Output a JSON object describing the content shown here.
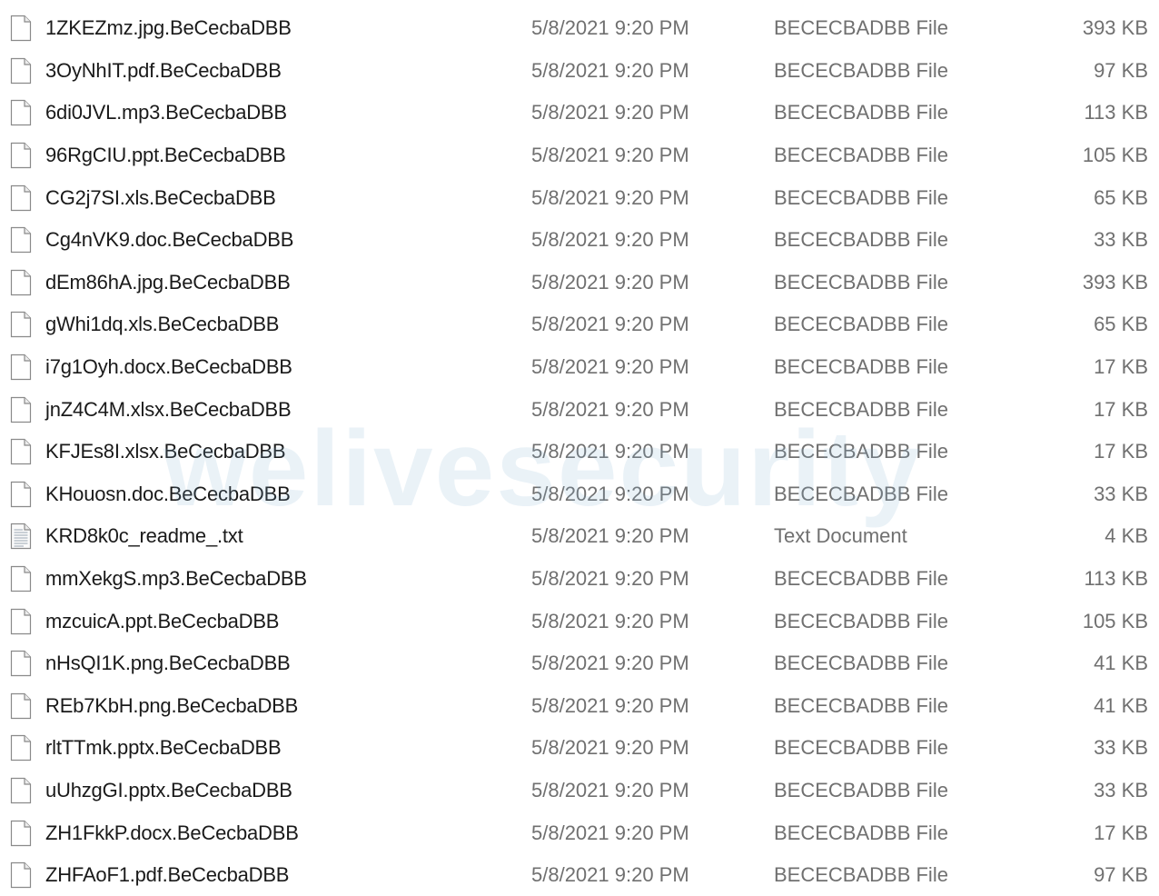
{
  "watermark": "welivesecurity",
  "files": [
    {
      "name": "1ZKEZmz.jpg.BeCecbaDBB",
      "date": "5/8/2021 9:20 PM",
      "type": "BECECBADBB File",
      "size": "393 KB",
      "icon": "blank-file-icon"
    },
    {
      "name": "3OyNhIT.pdf.BeCecbaDBB",
      "date": "5/8/2021 9:20 PM",
      "type": "BECECBADBB File",
      "size": "97 KB",
      "icon": "blank-file-icon"
    },
    {
      "name": "6di0JVL.mp3.BeCecbaDBB",
      "date": "5/8/2021 9:20 PM",
      "type": "BECECBADBB File",
      "size": "113 KB",
      "icon": "blank-file-icon"
    },
    {
      "name": "96RgCIU.ppt.BeCecbaDBB",
      "date": "5/8/2021 9:20 PM",
      "type": "BECECBADBB File",
      "size": "105 KB",
      "icon": "blank-file-icon"
    },
    {
      "name": "CG2j7SI.xls.BeCecbaDBB",
      "date": "5/8/2021 9:20 PM",
      "type": "BECECBADBB File",
      "size": "65 KB",
      "icon": "blank-file-icon"
    },
    {
      "name": "Cg4nVK9.doc.BeCecbaDBB",
      "date": "5/8/2021 9:20 PM",
      "type": "BECECBADBB File",
      "size": "33 KB",
      "icon": "blank-file-icon"
    },
    {
      "name": "dEm86hA.jpg.BeCecbaDBB",
      "date": "5/8/2021 9:20 PM",
      "type": "BECECBADBB File",
      "size": "393 KB",
      "icon": "blank-file-icon"
    },
    {
      "name": "gWhi1dq.xls.BeCecbaDBB",
      "date": "5/8/2021 9:20 PM",
      "type": "BECECBADBB File",
      "size": "65 KB",
      "icon": "blank-file-icon"
    },
    {
      "name": "i7g1Oyh.docx.BeCecbaDBB",
      "date": "5/8/2021 9:20 PM",
      "type": "BECECBADBB File",
      "size": "17 KB",
      "icon": "blank-file-icon"
    },
    {
      "name": "jnZ4C4M.xlsx.BeCecbaDBB",
      "date": "5/8/2021 9:20 PM",
      "type": "BECECBADBB File",
      "size": "17 KB",
      "icon": "blank-file-icon"
    },
    {
      "name": "KFJEs8I.xlsx.BeCecbaDBB",
      "date": "5/8/2021 9:20 PM",
      "type": "BECECBADBB File",
      "size": "17 KB",
      "icon": "blank-file-icon"
    },
    {
      "name": "KHouosn.doc.BeCecbaDBB",
      "date": "5/8/2021 9:20 PM",
      "type": "BECECBADBB File",
      "size": "33 KB",
      "icon": "blank-file-icon"
    },
    {
      "name": "KRD8k0c_readme_.txt",
      "date": "5/8/2021 9:20 PM",
      "type": "Text Document",
      "size": "4 KB",
      "icon": "text-document-icon"
    },
    {
      "name": "mmXekgS.mp3.BeCecbaDBB",
      "date": "5/8/2021 9:20 PM",
      "type": "BECECBADBB File",
      "size": "113 KB",
      "icon": "blank-file-icon"
    },
    {
      "name": "mzcuicA.ppt.BeCecbaDBB",
      "date": "5/8/2021 9:20 PM",
      "type": "BECECBADBB File",
      "size": "105 KB",
      "icon": "blank-file-icon"
    },
    {
      "name": "nHsQI1K.png.BeCecbaDBB",
      "date": "5/8/2021 9:20 PM",
      "type": "BECECBADBB File",
      "size": "41 KB",
      "icon": "blank-file-icon"
    },
    {
      "name": "REb7KbH.png.BeCecbaDBB",
      "date": "5/8/2021 9:20 PM",
      "type": "BECECBADBB File",
      "size": "41 KB",
      "icon": "blank-file-icon"
    },
    {
      "name": "rltTTmk.pptx.BeCecbaDBB",
      "date": "5/8/2021 9:20 PM",
      "type": "BECECBADBB File",
      "size": "33 KB",
      "icon": "blank-file-icon"
    },
    {
      "name": "uUhzgGI.pptx.BeCecbaDBB",
      "date": "5/8/2021 9:20 PM",
      "type": "BECECBADBB File",
      "size": "33 KB",
      "icon": "blank-file-icon"
    },
    {
      "name": "ZH1FkkP.docx.BeCecbaDBB",
      "date": "5/8/2021 9:20 PM",
      "type": "BECECBADBB File",
      "size": "17 KB",
      "icon": "blank-file-icon"
    },
    {
      "name": "ZHFAoF1.pdf.BeCecbaDBB",
      "date": "5/8/2021 9:20 PM",
      "type": "BECECBADBB File",
      "size": "97 KB",
      "icon": "blank-file-icon"
    }
  ]
}
